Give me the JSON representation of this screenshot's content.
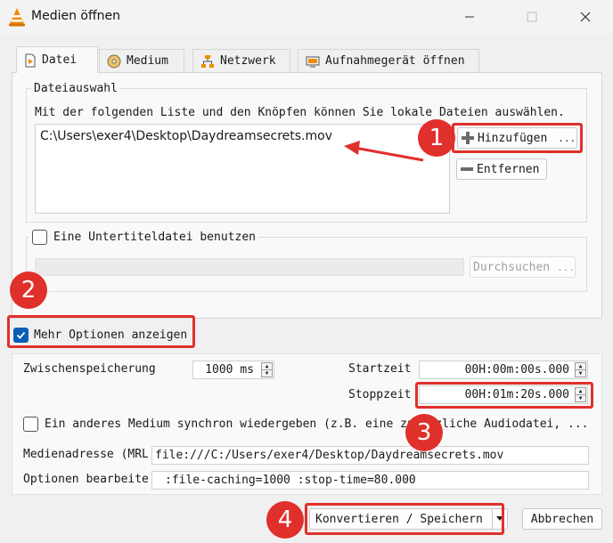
{
  "window": {
    "title": "Medien öffnen"
  },
  "tabs": [
    {
      "label": "Datei",
      "icon": "file-icon"
    },
    {
      "label": "Medium",
      "icon": "disc-icon"
    },
    {
      "label": "Netzwerk",
      "icon": "network-icon"
    },
    {
      "label": "Aufnahmegerät öffnen",
      "icon": "capture-device-icon"
    }
  ],
  "file_selection": {
    "group_label": "Dateiauswahl",
    "description": "Mit der folgenden Liste und den Knöpfen können Sie lokale Dateien auswählen.",
    "files": [
      "C:\\Users\\exer4\\Desktop\\Daydreamsecrets.mov"
    ],
    "add_button": "Hinzufügen",
    "add_more": "...",
    "remove_button": "Entfernen"
  },
  "subtitle": {
    "checkbox_label": "Eine Untertiteldatei benutzen",
    "browse_button": "Durchsuchen",
    "browse_more": "...",
    "checked": false
  },
  "more_options": {
    "label": "Mehr Optionen anzeigen",
    "checked": true
  },
  "options": {
    "caching_label": "Zwischenspeicherung",
    "caching_value": "1000 ms",
    "start_label": "Startzeit",
    "start_value": "00H:00m:00s.000",
    "stop_label": "Stoppzeit",
    "stop_value": "00H:01m:20s.000",
    "sync_label": "Ein anderes Medium synchron wiedergeben (z.B. eine zusätzliche Audiodatei, ...",
    "sync_checked": false,
    "mrl_label": "Medienadresse (MRL",
    "mrl_value": "file:///C:/Users/exer4/Desktop/Daydreamsecrets.mov",
    "edit_options_label": "Optionen bearbeiten",
    "edit_options_value": ":file-caching=1000 :stop-time=80.000"
  },
  "footer": {
    "convert_button": "Konvertieren / Speichern",
    "cancel_button": "Abbrechen"
  },
  "annotations": {
    "step1": "1",
    "step2": "2",
    "step3": "3",
    "step4": "4",
    "color": "#e0302c"
  }
}
